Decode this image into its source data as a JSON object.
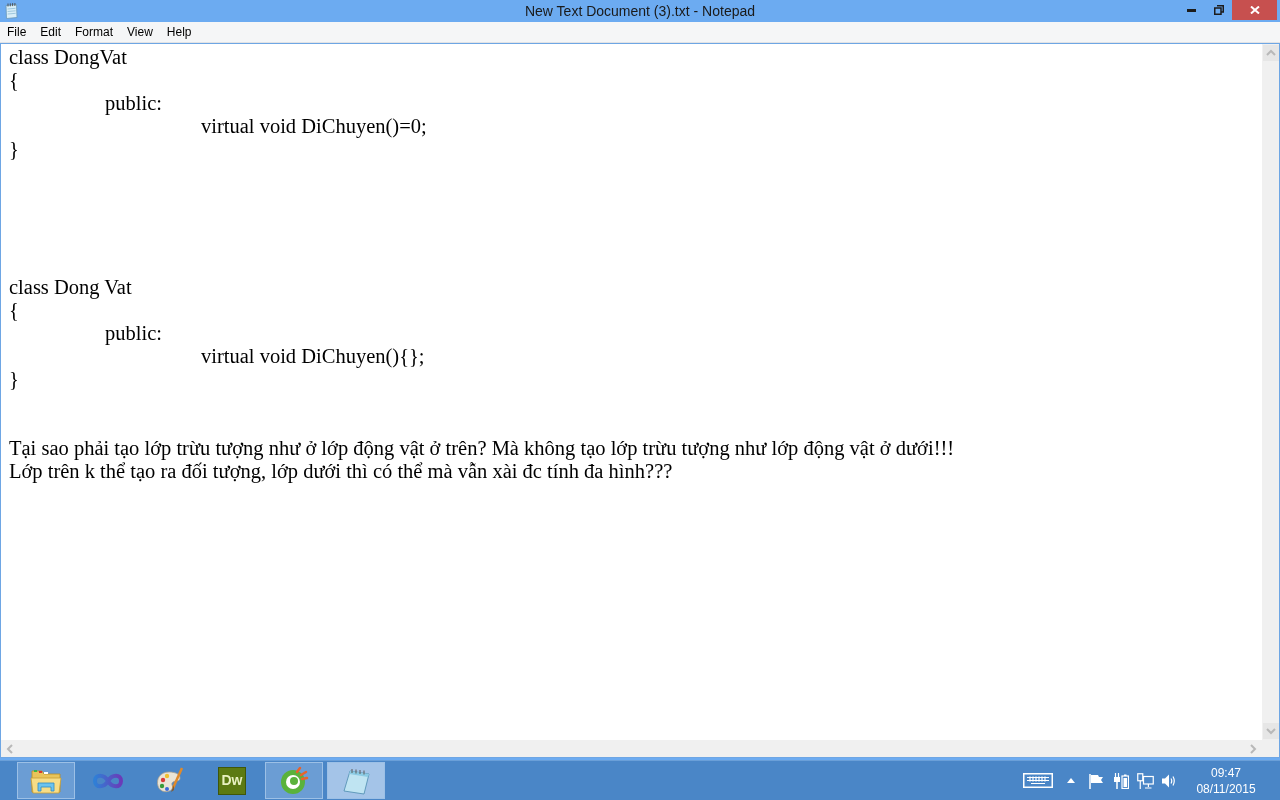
{
  "window": {
    "title": "New Text Document (3).txt - Notepad"
  },
  "menu": [
    "File",
    "Edit",
    "Format",
    "View",
    "Help"
  ],
  "document": {
    "text": "class DongVat\n{\n\tpublic:\n\t\tvirtual void DiChuyen()=0;\n}\n\n\n\n\n\nclass Dong Vat\n{\n\tpublic:\n\t\tvirtual void DiChuyen(){};\n}\n\n\nTại sao phải tạo lớp trừu tượng như ở lớp động vật ở trên? Mà không tạo lớp trừu tượng như lớp động vật ở dưới!!!\nLớp trên k thể tạo ra đối tượng, lớp dưới thì có thể mà vẫn xài đc tính đa hình???"
  },
  "taskbar": {
    "items": [
      {
        "kind": "folder",
        "running": true,
        "selected": false
      },
      {
        "kind": "infinity",
        "running": false,
        "selected": false
      },
      {
        "kind": "palette",
        "running": false,
        "selected": false
      },
      {
        "kind": "tile",
        "label": "Dw",
        "running": false,
        "selected": false
      },
      {
        "kind": "circle-logo",
        "running": true,
        "selected": false
      },
      {
        "kind": "notepad",
        "running": true,
        "selected": true
      }
    ],
    "clock": {
      "time": "09:47",
      "date": "08/11/2015"
    }
  }
}
